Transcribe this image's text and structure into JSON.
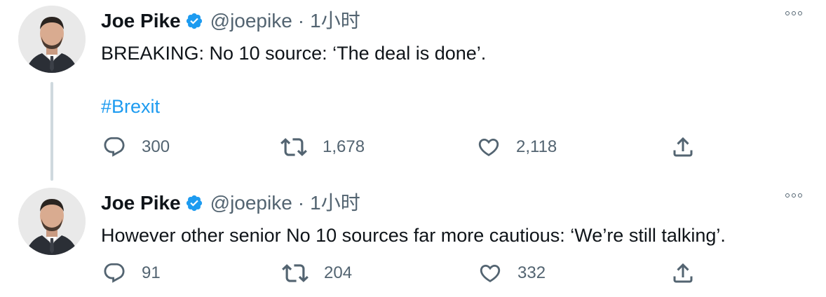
{
  "tweets": [
    {
      "author": "Joe Pike",
      "handle": "@joepike",
      "separator": "·",
      "time": "1小时",
      "text": "BREAKING: No 10 source: ‘The deal is done’.",
      "hashtag": "#Brexit",
      "replies": "300",
      "retweets": "1,678",
      "likes": "2,118"
    },
    {
      "author": "Joe Pike",
      "handle": "@joepike",
      "separator": "·",
      "time": "1小时",
      "text": "However other senior No 10 sources far more cautious: ‘We’re still talking’.",
      "replies": "91",
      "retweets": "204",
      "likes": "332"
    }
  ],
  "icons": {
    "verified": "verified-badge-icon",
    "more": "more-icon",
    "reply": "reply-icon",
    "retweet": "retweet-icon",
    "like": "heart-icon",
    "share": "share-icon"
  },
  "colors": {
    "text": "#0f1419",
    "secondary": "#536471",
    "link": "#1d9bf0",
    "verified": "#1d9bf0",
    "thread_line": "#cfd9de"
  }
}
